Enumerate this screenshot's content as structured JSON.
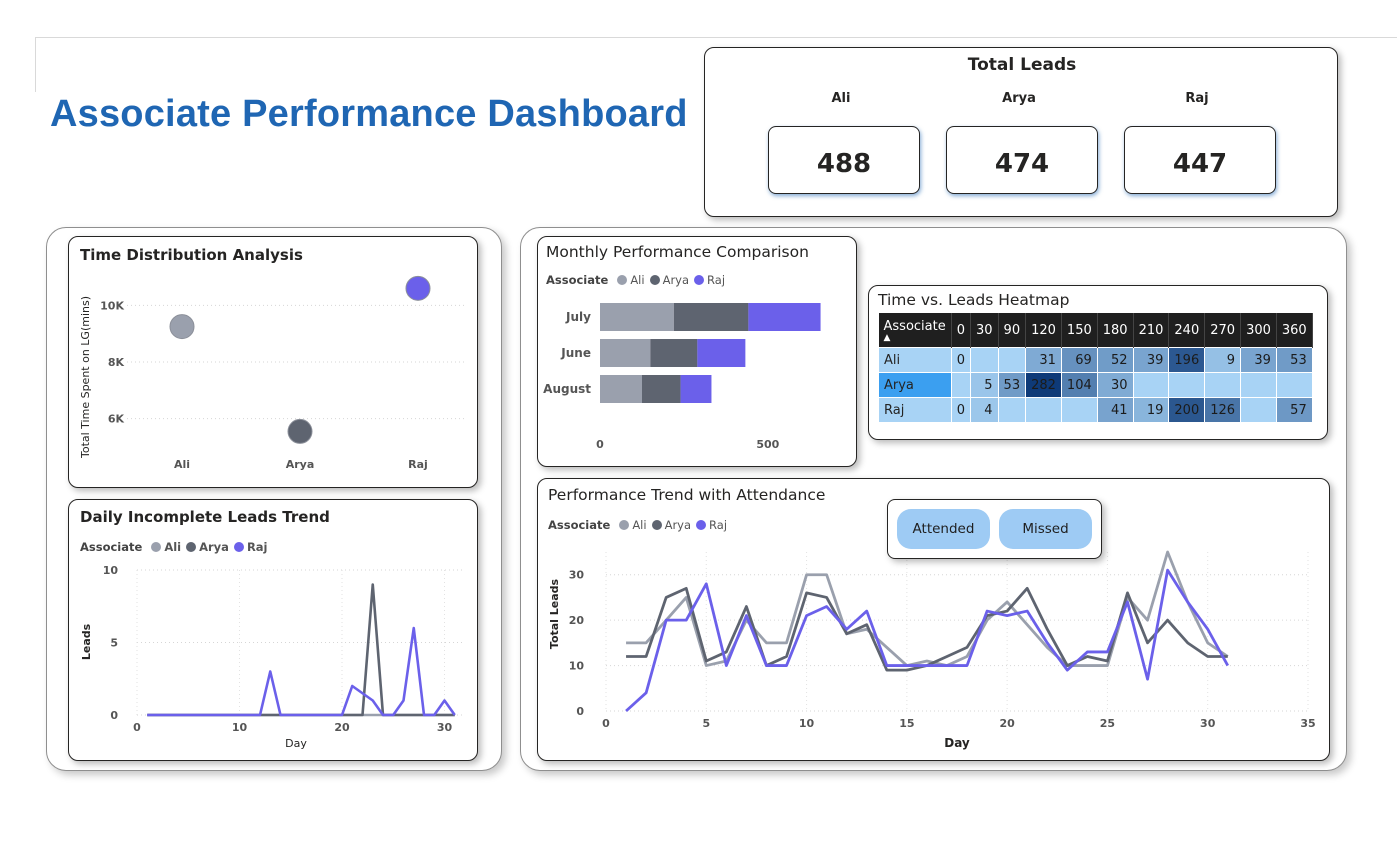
{
  "page_title": "Associate Performance Dashboard",
  "colors": {
    "ali": "#9aa0ad",
    "arya": "#5e6470",
    "raj": "#6b60ea",
    "title_blue": "#1f66b3"
  },
  "total_leads": {
    "title": "Total Leads",
    "associates": [
      {
        "name": "Ali",
        "value": "488"
      },
      {
        "name": "Arya",
        "value": "474"
      },
      {
        "name": "Raj",
        "value": "447"
      }
    ]
  },
  "chart_data": [
    {
      "id": "time_distribution",
      "type": "scatter",
      "title": "Time Distribution Analysis",
      "xlabel": "",
      "ylabel": "Total Time Spent on LG(mins)",
      "categories": [
        "Ali",
        "Arya",
        "Raj"
      ],
      "values": [
        9250,
        5550,
        10600
      ],
      "ylim": [
        5000,
        11000
      ],
      "yticks": [
        6000,
        8000,
        10000
      ],
      "ytick_labels": [
        "6K",
        "8K",
        "10K"
      ],
      "grid": true
    },
    {
      "id": "daily_incomplete",
      "type": "line",
      "title": "Daily Incomplete Leads Trend",
      "legend_title": "Associate",
      "legend": [
        "Ali",
        "Arya",
        "Raj"
      ],
      "xlabel": "Day",
      "ylabel": "Leads",
      "xlim": [
        0,
        32
      ],
      "ylim": [
        0,
        10
      ],
      "xticks": [
        0,
        10,
        20,
        30
      ],
      "yticks": [
        0,
        5,
        10
      ],
      "x": [
        1,
        2,
        3,
        4,
        5,
        6,
        7,
        8,
        9,
        10,
        11,
        12,
        13,
        14,
        15,
        16,
        17,
        18,
        19,
        20,
        21,
        22,
        23,
        24,
        25,
        26,
        27,
        28,
        29,
        30,
        31
      ],
      "series": [
        {
          "name": "Ali",
          "values": [
            0,
            0,
            0,
            0,
            0,
            0,
            0,
            0,
            0,
            0,
            0,
            0,
            0,
            0,
            0,
            0,
            0,
            0,
            0,
            0,
            0,
            0,
            0,
            0,
            0,
            0,
            0,
            0,
            0,
            0,
            0
          ]
        },
        {
          "name": "Arya",
          "values": [
            0,
            0,
            0,
            0,
            0,
            0,
            0,
            0,
            0,
            0,
            0,
            0,
            0,
            0,
            0,
            0,
            0,
            0,
            0,
            0,
            0,
            0,
            9,
            0,
            0,
            0,
            0,
            0,
            0,
            0,
            0
          ]
        },
        {
          "name": "Raj",
          "values": [
            0,
            0,
            0,
            0,
            0,
            0,
            0,
            0,
            0,
            0,
            0,
            0,
            3,
            0,
            0,
            0,
            0,
            0,
            0,
            0,
            2,
            1.5,
            1,
            0,
            0,
            1,
            6,
            0,
            0,
            1,
            0
          ]
        }
      ]
    },
    {
      "id": "monthly_comparison",
      "type": "bar",
      "stacked": true,
      "orientation": "horizontal",
      "title": "Monthly Performance Comparison",
      "legend_title": "Associate",
      "legend": [
        "Ali",
        "Arya",
        "Raj"
      ],
      "categories": [
        "July",
        "June",
        "August"
      ],
      "series": [
        {
          "name": "Ali",
          "values": [
            220,
            150,
            125
          ]
        },
        {
          "name": "Arya",
          "values": [
            222,
            140,
            115
          ]
        },
        {
          "name": "Raj",
          "values": [
            215,
            143,
            92
          ]
        }
      ],
      "xlim": [
        0,
        700
      ],
      "xticks": [
        0,
        500
      ]
    },
    {
      "id": "heatmap",
      "type": "heatmap",
      "title": "Time vs. Leads Heatmap",
      "row_header": "Associate",
      "columns": [
        "0",
        "30",
        "90",
        "120",
        "150",
        "180",
        "210",
        "240",
        "270",
        "300",
        "360"
      ],
      "rows": [
        {
          "name": "Ali",
          "cells": [
            "0",
            "",
            "",
            "31",
            "69",
            "52",
            "39",
            "196",
            "9",
            "39",
            "53"
          ]
        },
        {
          "name": "Arya",
          "cells": [
            "",
            "5",
            "53",
            "282",
            "104",
            "30",
            "",
            "",
            "",
            "",
            ""
          ]
        },
        {
          "name": "Raj",
          "cells": [
            "0",
            "4",
            "",
            "",
            "",
            "41",
            "19",
            "200",
            "126",
            "",
            "57"
          ]
        }
      ]
    },
    {
      "id": "performance_trend",
      "type": "line",
      "title": "Performance Trend with Attendance",
      "legend_title": "Associate",
      "legend": [
        "Ali",
        "Arya",
        "Raj"
      ],
      "xlabel": "Day",
      "ylabel": "Total Leads",
      "xlim": [
        0,
        35
      ],
      "ylim": [
        0,
        35
      ],
      "xticks": [
        0,
        5,
        10,
        15,
        20,
        25,
        30,
        35
      ],
      "yticks": [
        0,
        10,
        20,
        30
      ],
      "x": [
        1,
        2,
        3,
        4,
        5,
        6,
        7,
        8,
        9,
        10,
        11,
        12,
        13,
        14,
        15,
        16,
        17,
        18,
        19,
        20,
        21,
        22,
        23,
        24,
        25,
        26,
        27,
        28,
        29,
        30,
        31
      ],
      "series": [
        {
          "name": "Ali",
          "values": [
            15,
            15,
            20,
            25,
            10,
            11,
            20,
            15,
            15,
            30,
            30,
            17,
            18,
            14,
            10,
            11,
            10,
            12,
            20,
            24,
            19,
            14,
            10,
            10,
            10,
            25,
            20,
            35,
            24,
            15,
            12
          ]
        },
        {
          "name": "Arya",
          "values": [
            12,
            12,
            25,
            27,
            11,
            13,
            23,
            10,
            12,
            26,
            25,
            17,
            19,
            9,
            9,
            10,
            12,
            14,
            21,
            22,
            27,
            18,
            10,
            12,
            11,
            26,
            15,
            20,
            15,
            12,
            12
          ]
        },
        {
          "name": "Raj",
          "values": [
            0,
            4,
            20,
            20,
            28,
            10,
            21,
            10,
            10,
            21,
            23,
            18,
            22,
            10,
            10,
            10,
            10,
            10,
            22,
            21,
            22,
            15,
            9,
            13,
            13,
            24,
            7,
            31,
            24,
            18,
            10
          ]
        }
      ]
    }
  ],
  "attendance": {
    "attended": "Attended",
    "missed": "Missed"
  }
}
